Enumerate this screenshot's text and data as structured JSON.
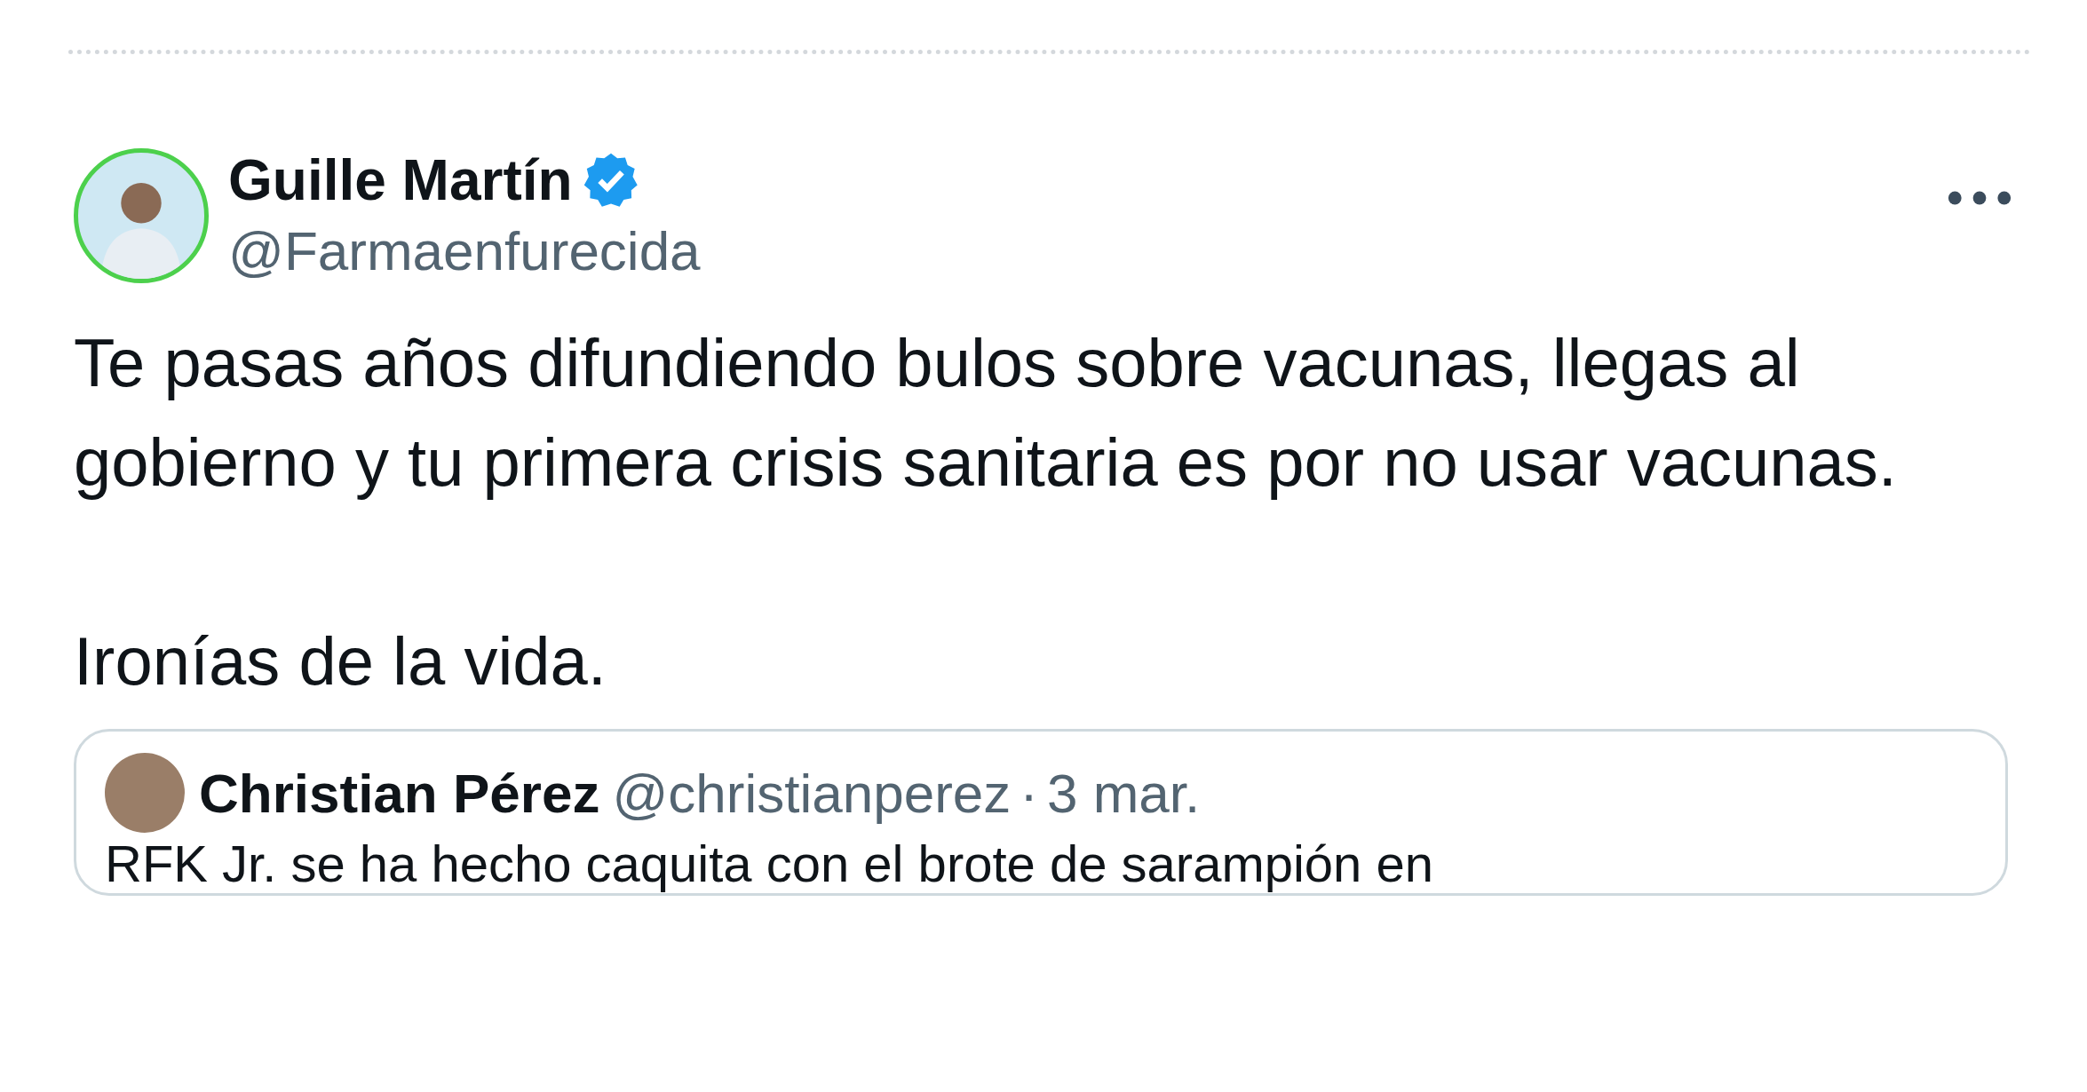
{
  "tweet": {
    "author": {
      "name": "Guille Martín",
      "verified": true,
      "handle": "@Farmaenfurecida"
    },
    "text": "Te pasas años difundiendo bulos sobre vacunas, llegas al gobierno y tu primera crisis sanitaria es por no usar vacunas.\n\nIronías de la vida.",
    "quoted": {
      "name": "Christian Pérez",
      "handle": "@christianperez",
      "separator": "·",
      "date": "3 mar.",
      "text": "RFK Jr. se ha hecho caquita con el brote de sarampión en"
    }
  }
}
